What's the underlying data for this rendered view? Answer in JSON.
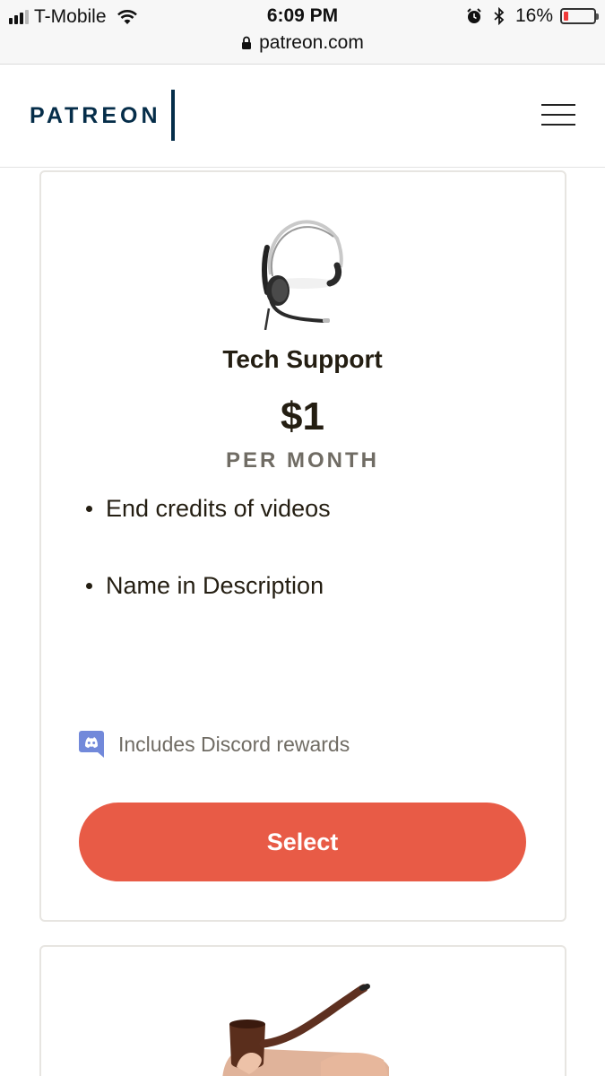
{
  "status_bar": {
    "carrier": "T-Mobile",
    "time": "6:09 PM",
    "battery_percent": "16%",
    "battery_level": 0.16,
    "url": "patreon.com"
  },
  "header": {
    "logo": "PATREON"
  },
  "tier": {
    "name": "Tech Support",
    "price": "$1",
    "period": "PER MONTH",
    "benefits": [
      "End credits of videos",
      "Name in Description"
    ],
    "discord_note": "Includes Discord rewards",
    "select_label": "Select",
    "button_color": "#e85b46"
  },
  "colors": {
    "brand_navy": "#052d49",
    "discord_blurple": "#7289da",
    "text_dark": "#241e12",
    "text_muted": "#706c64"
  }
}
